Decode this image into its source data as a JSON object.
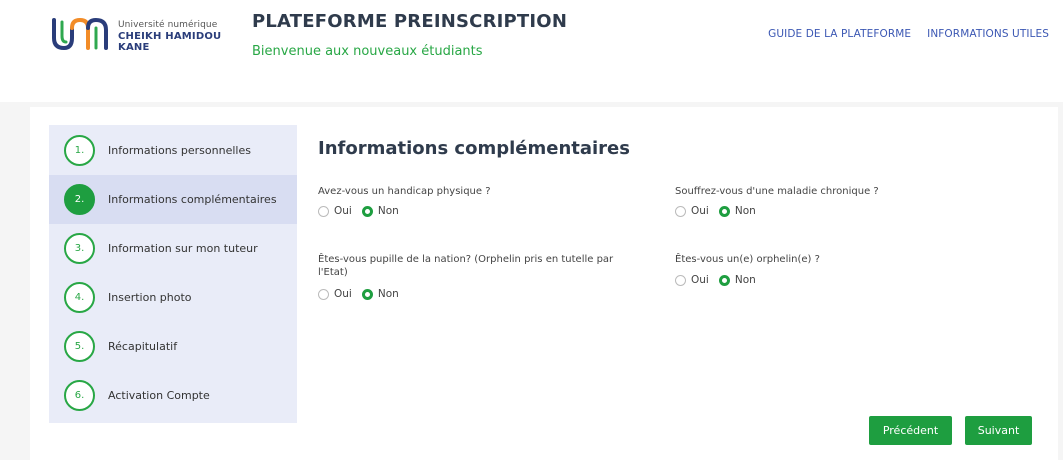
{
  "header": {
    "logo": {
      "line1": "Université numérique",
      "line2": "CHEIKH HAMIDOU KANE"
    },
    "title": "PLATEFORME PREINSCRIPTION",
    "subtitle": "Bienvenue aux nouveaux étudiants",
    "nav": [
      "GUIDE DE LA PLATEFORME",
      "INFORMATIONS UTILES"
    ]
  },
  "steps": [
    {
      "num": "1.",
      "label": "Informations personnelles",
      "active": false
    },
    {
      "num": "2.",
      "label": "Informations complémentaires",
      "active": true
    },
    {
      "num": "3.",
      "label": "Information sur mon tuteur",
      "active": false
    },
    {
      "num": "4.",
      "label": "Insertion photo",
      "active": false
    },
    {
      "num": "5.",
      "label": "Récapitulatif",
      "active": false
    },
    {
      "num": "6.",
      "label": "Activation Compte",
      "active": false
    }
  ],
  "form": {
    "title": "Informations complémentaires",
    "questions": [
      {
        "label": "Avez-vous un handicap physique ?",
        "options": [
          "Oui",
          "Non"
        ],
        "selected": "Non"
      },
      {
        "label": "Souffrez-vous d'une maladie chronique ?",
        "options": [
          "Oui",
          "Non"
        ],
        "selected": "Non"
      },
      {
        "label": "Êtes-vous pupille de la nation? (Orphelin pris en tutelle par l'Etat)",
        "options": [
          "Oui",
          "Non"
        ],
        "selected": "Non"
      },
      {
        "label": "Êtes-vous un(e) orphelin(e) ?",
        "options": [
          "Oui",
          "Non"
        ],
        "selected": "Non"
      }
    ]
  },
  "buttons": {
    "previous": "Précédent",
    "next": "Suivant"
  },
  "colors": {
    "accent": "#1e9e40",
    "link": "#3b57b3",
    "sidebar": "#e9ecf8",
    "logo_blue": "#2a3d7a",
    "logo_orange": "#f28c28"
  }
}
